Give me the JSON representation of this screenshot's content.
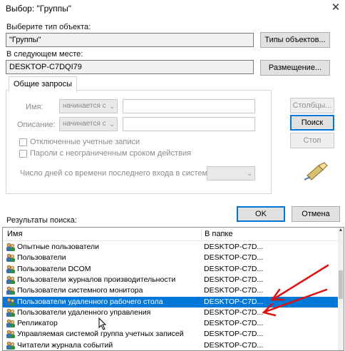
{
  "window": {
    "title": "Выбор: \"Группы\""
  },
  "object_type": {
    "label": "Выберите тип объекта:",
    "value": "\"Группы\"",
    "button": "Типы объектов..."
  },
  "location": {
    "label": "В следующем месте:",
    "value": "DESKTOP-C7DQI79",
    "button": "Размещение..."
  },
  "common_queries": {
    "tab": "Общие запросы",
    "name_label": "Имя:",
    "name_mode": "начинается с",
    "desc_label": "Описание:",
    "desc_mode": "начинается с",
    "disabled_accounts": "Отключенные учетные записи",
    "no_expire_passwords": "Пароли с неограниченным сроком действия",
    "days_label": "Число дней со времени последнего входа в систему:"
  },
  "side_buttons": {
    "columns": "Столбцы...",
    "search": "Поиск",
    "stop": "Стоп"
  },
  "dialog_buttons": {
    "ok": "OK",
    "cancel": "Отмена"
  },
  "results": {
    "label": "Результаты поиска:",
    "columns": [
      "Имя",
      "В папке"
    ],
    "rows": [
      {
        "name": "Опытные пользователи",
        "folder": "DESKTOP-C7D..."
      },
      {
        "name": "Пользователи",
        "folder": "DESKTOP-C7D..."
      },
      {
        "name": "Пользователи DCOM",
        "folder": "DESKTOP-C7D..."
      },
      {
        "name": "Пользователи журналов производительности",
        "folder": "DESKTOP-C7D..."
      },
      {
        "name": "Пользователи системного монитора",
        "folder": "DESKTOP-C7D..."
      },
      {
        "name": "Пользователи удаленного рабочего стола",
        "folder": "DESKTOP-C7D..."
      },
      {
        "name": "Пользователи удаленного управления",
        "folder": "DESKTOP-C7D..."
      },
      {
        "name": "Репликатор",
        "folder": "DESKTOP-C7D..."
      },
      {
        "name": "Управляемая системой группа учетных записей",
        "folder": "DESKTOP-C7D..."
      },
      {
        "name": "Читатели журнала событий",
        "folder": "DESKTOP-C7D..."
      }
    ],
    "selected_row": "Пользователи удаленного рабочего стола"
  },
  "colors": {
    "selection": "#0078d7",
    "annotation_arrow": "#e01010"
  },
  "icons": [
    "close-icon",
    "search-flashlight-icon",
    "group-icon",
    "mouse-cursor-icon",
    "annotation-arrow"
  ]
}
